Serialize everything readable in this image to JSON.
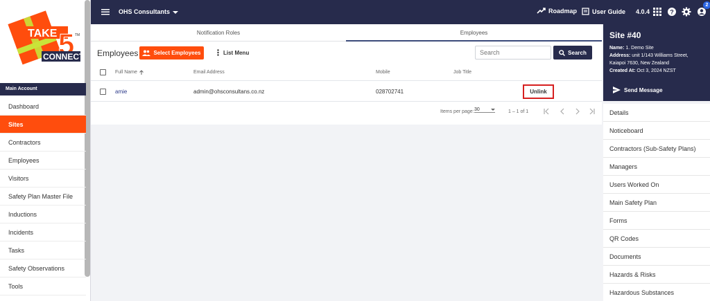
{
  "sidebar": {
    "section": "Main Account",
    "items": [
      {
        "label": "Dashboard"
      },
      {
        "label": "Sites"
      },
      {
        "label": "Contractors"
      },
      {
        "label": "Employees"
      },
      {
        "label": "Visitors"
      },
      {
        "label": "Safety Plan Master File"
      },
      {
        "label": "Inductions"
      },
      {
        "label": "Incidents"
      },
      {
        "label": "Tasks"
      },
      {
        "label": "Safety Observations"
      },
      {
        "label": "Tools"
      }
    ],
    "active_index": 1
  },
  "logo": {
    "text_take": "TAKE",
    "text_five": "5",
    "text_connect": "CONNECT",
    "tm": "TM"
  },
  "topbar": {
    "org": "OHS Consultants",
    "roadmap": "Roadmap",
    "user_guide": "User Guide",
    "version": "4.0.4",
    "notification_count": "2"
  },
  "tabs": [
    {
      "label": "Notification Roles"
    },
    {
      "label": "Employees"
    }
  ],
  "main": {
    "title": "Employees",
    "select_button": "Select Employees",
    "list_menu": "List Menu",
    "search_placeholder": "Search",
    "search_button": "Search",
    "columns": [
      "Full Name",
      "Email Address",
      "Mobile",
      "Job Title"
    ],
    "rows": [
      {
        "name": "amie",
        "email": "admin@ohsconsultans.co.nz",
        "mobile": "028702741",
        "job_title": "",
        "action": "Unlink"
      }
    ],
    "pager": {
      "items_per_page_label": "Items per page:",
      "items_per_page": "30",
      "range": "1 – 1 of 1"
    }
  },
  "site_panel": {
    "title": "Site #40",
    "name_label": "Name:",
    "name": "1. Demo Site",
    "address_label": "Address:",
    "address": "unit 1/143 Williams Street, Kaiapoi 7630, New Zealand",
    "created_label": "Created At:",
    "created": "Oct 3, 2024 NZST",
    "send_message": "Send Message",
    "menu": [
      {
        "label": "Details"
      },
      {
        "label": "Noticeboard"
      },
      {
        "label": "Contractors (Sub-Safety Plans)"
      },
      {
        "label": "Managers"
      },
      {
        "label": "Users Worked On"
      },
      {
        "label": "Main Safety Plan"
      },
      {
        "label": "Forms"
      },
      {
        "label": "QR Codes"
      },
      {
        "label": "Documents"
      },
      {
        "label": "Hazards & Risks"
      },
      {
        "label": "Hazardous Substances"
      }
    ]
  },
  "colors": {
    "navy": "#272b4c",
    "orange": "#ff4d0d",
    "highlight_red": "#d61f1f",
    "badge_blue": "#2b66e5"
  }
}
